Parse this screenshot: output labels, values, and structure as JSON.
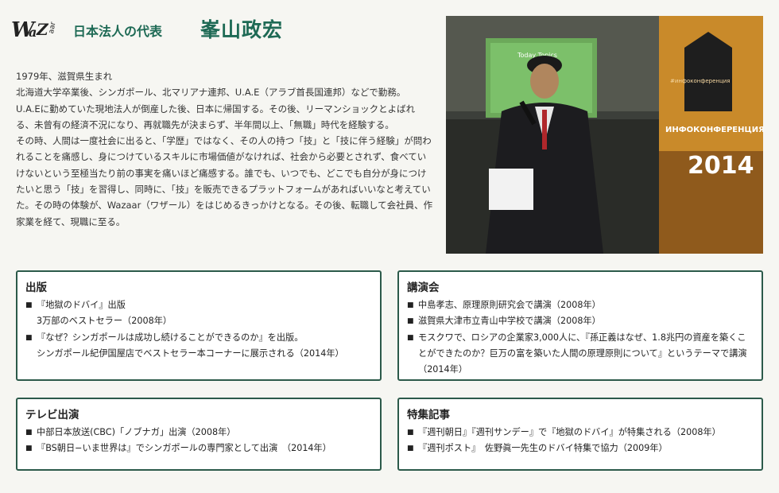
{
  "header": {
    "logo_text": "WaZaar",
    "role": "日本法人の代表",
    "name": "峯山政宏"
  },
  "bio": [
    "1979年、滋賀県生まれ",
    "北海道大学卒業後、シンガポール、北マリアナ連邦、U.A.E（アラブ首長国連邦）などで勤務。",
    "U.A.Eに勤めていた現地法人が倒産した後、日本に帰国する。その後、リーマンショックとよばれる、未曾有の経済不況になり、再就職先が決まらず、半年間以上、「無職」時代を経験する。",
    "その時、人間は一度社会に出ると、「学歴」ではなく、その人の持つ「技」と「技に伴う経験」が問われることを痛感し、身につけているスキルに市場価値がなければ、社会から必要とされず、食べていけないという至極当たり前の事実を痛いほど痛感する。誰でも、いつでも、どこでも自分が身につけたいと思う「技」を習得し、同時に、「技」を販売できるプラットフォームがあればいいなと考えていた。その時の体験が、Wazaar（ワザール）をはじめるきっかけとなる。その後、転職して会社員、作家業を経て、現職に至る。"
  ],
  "photo": {
    "screen_text": "Today Topics",
    "banner_title": "ИНФОКОНФЕРЕНЦИЯ",
    "banner_year": "2014",
    "banner_small": "#инфоконференция"
  },
  "publishing": {
    "title": "出版",
    "items": [
      {
        "line1": "『地獄のドバイ』出版",
        "line2": "3万部のベストセラー（2008年）"
      },
      {
        "line1": "『なぜ？シンガポールは成功し続けることができるのか』を出版。",
        "line2": "シンガポール紀伊国屋店でベストセラー本コーナーに展示される（2014年）"
      }
    ]
  },
  "lectures": {
    "title": "講演会",
    "items": [
      "中島孝志、原理原則研究会で講演（2008年）",
      "滋賀県大津市立青山中学校で講演（2008年）",
      "モスクワで、ロシアの企業家3,000人に、『孫正義はなぜ、1.8兆円の資産を築くことができたのか？巨万の富を築いた人間の原理原則について』というテーマで講演（2014年）"
    ]
  },
  "tv": {
    "title": "テレビ出演",
    "items": [
      "中部日本放送(CBC)「ノブナガ」出演（2008年）",
      "『BS朝日−いま世界は』でシンガポールの専門家として出演　（2014年）"
    ]
  },
  "features": {
    "title": "特集記事",
    "items": [
      "『週刊朝日』『週刊サンデー』で『地獄のドバイ』が特集される（2008年）",
      "『週刊ポスト』　佐野眞一先生のドバイ特集で協力（2009年）"
    ]
  }
}
